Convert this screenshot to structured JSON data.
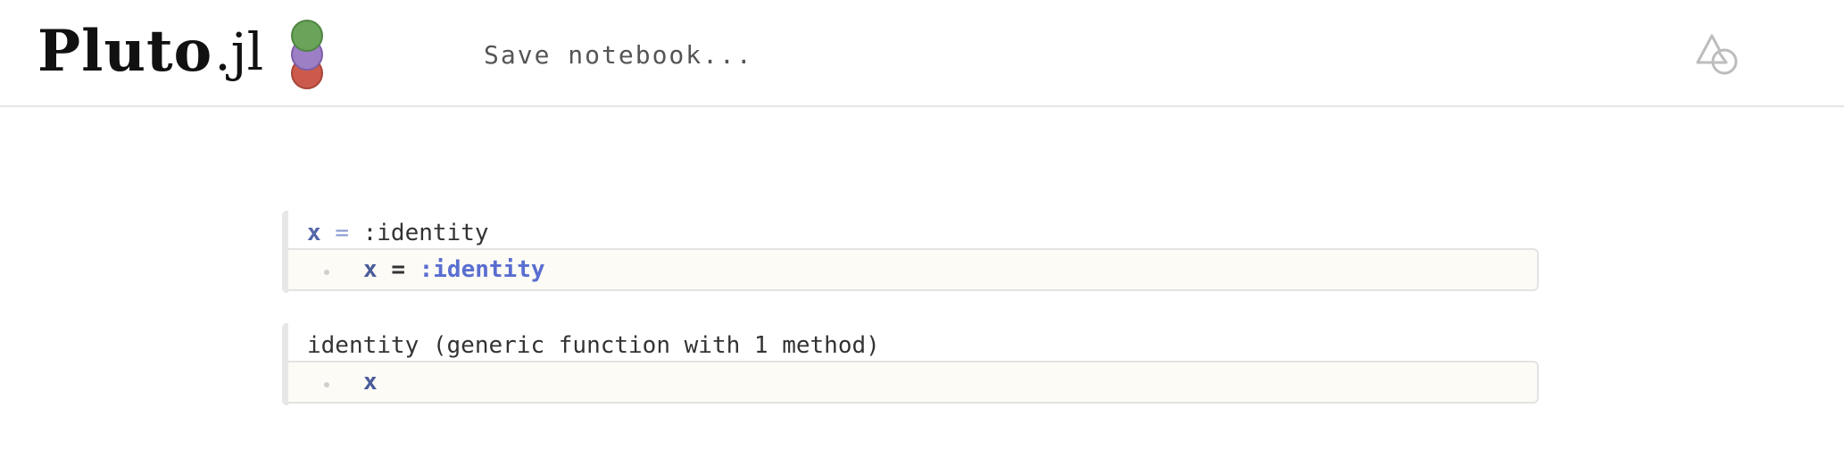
{
  "header": {
    "logo_main": "Pluto",
    "logo_ext": ".jl",
    "save_label": "Save notebook...",
    "icons": {
      "logo_dots": "pluto-logo-dots",
      "run_icon": "shapes-triangle-circle-icon"
    },
    "colors": {
      "dot_green": "#6aa35a",
      "dot_purple": "#9d7fc6",
      "dot_red": "#cc5a4c"
    }
  },
  "cells": [
    {
      "output": {
        "var": "x",
        "op": "=",
        "value": ":identity"
      },
      "code": {
        "var": "x",
        "eq": "=",
        "value": ":identity"
      }
    },
    {
      "output": {
        "text": "identity (generic function with 1 method)"
      },
      "code": {
        "var": "x"
      }
    }
  ]
}
